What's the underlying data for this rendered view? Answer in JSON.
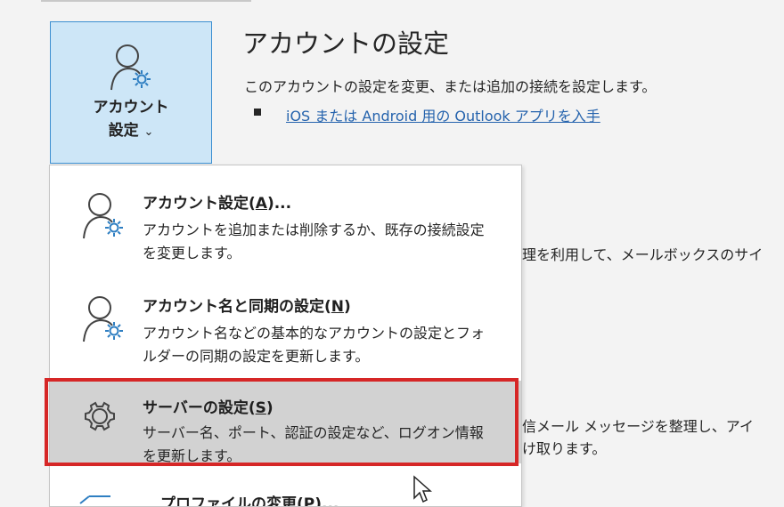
{
  "account_settings_button": {
    "line1": "アカウント",
    "line2": "設定",
    "chevron": "⌄",
    "icon": "person-gear-icon"
  },
  "section": {
    "title": "アカウントの設定",
    "description": "このアカウントの設定を変更、または追加の接続を設定します。",
    "link": "iOS または Android 用の Outlook アプリを入手"
  },
  "background_text": [
    "理を利用して、メールボックスのサイ",
    "信メール メッセージを整理し、アイ",
    "け取ります。"
  ],
  "menu": {
    "items": [
      {
        "title": "アカウント設定(",
        "accel": "A",
        "title_suffix": ")...",
        "description": "アカウントを追加または削除するか、既存の接続設定を変更します。",
        "icon": "person-gear-icon"
      },
      {
        "title": "アカウント名と同期の設定(",
        "accel": "N",
        "title_suffix": ")",
        "description": "アカウント名などの基本的なアカウントの設定とフォルダーの同期の設定を更新します。",
        "icon": "person-gear-icon"
      },
      {
        "title": "サーバーの設定(",
        "accel": "S",
        "title_suffix": ")",
        "description": "サーバー名、ポート、認証の設定など、ログオン情報を更新します。",
        "icon": "gear-icon"
      },
      {
        "title": "プロファイルの変更(P)...",
        "icon": "arrow-icon"
      }
    ]
  },
  "colors": {
    "button_bg": "#cde6f7",
    "button_border": "#3c8fd1",
    "highlight": "#d62626",
    "link": "#2563ad",
    "hover_bg": "#d2d2d2"
  }
}
